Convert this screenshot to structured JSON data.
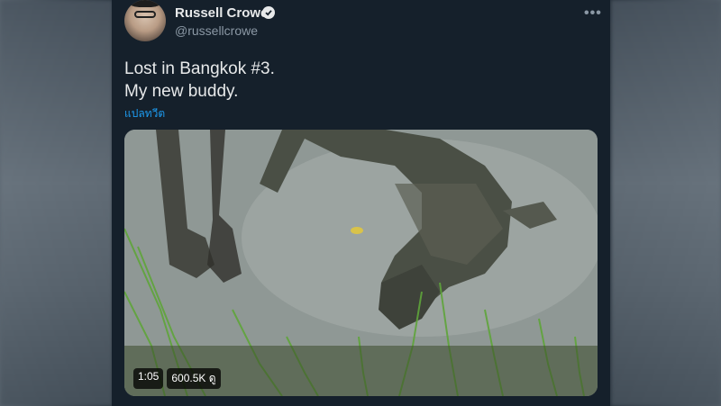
{
  "tweet": {
    "author_name": "Russell Crowe",
    "author_handle": "@russellcrowe",
    "text_lines": [
      "Lost in Bangkok #3.",
      "My new buddy."
    ],
    "translate_label": "แปลทวีต",
    "more_icon": "more-dots-icon",
    "verified_icon": "verified-badge-icon"
  },
  "video": {
    "duration": "1:05",
    "views": "600.5K ดู"
  },
  "colors": {
    "card_bg": "#15202b",
    "primary_text": "#e7e9ea",
    "secondary_text": "#8b98a5",
    "link": "#1d9bf0"
  }
}
